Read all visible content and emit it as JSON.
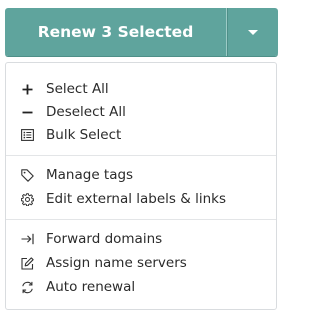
{
  "renew_button": {
    "label": "Renew 3 Selected",
    "toggle_icon": "caret-down-icon"
  },
  "colors": {
    "accent": "#5fa49d",
    "menu_border": "#d9dcdf",
    "text": "#2b2b2b"
  },
  "menu": {
    "selection": [
      {
        "label": "Select All",
        "icon": "plus-icon"
      },
      {
        "label": "Deselect All",
        "icon": "minus-icon"
      },
      {
        "label": "Bulk Select",
        "icon": "list-icon"
      }
    ],
    "labels": [
      {
        "label": "Manage tags",
        "icon": "tag-icon"
      },
      {
        "label": "Edit external labels & links",
        "icon": "gear-icon"
      }
    ],
    "actions": [
      {
        "label": "Forward domains",
        "icon": "forward-arrow-icon"
      },
      {
        "label": "Assign name servers",
        "icon": "edit-icon"
      },
      {
        "label": "Auto renewal",
        "icon": "sync-icon"
      }
    ]
  }
}
